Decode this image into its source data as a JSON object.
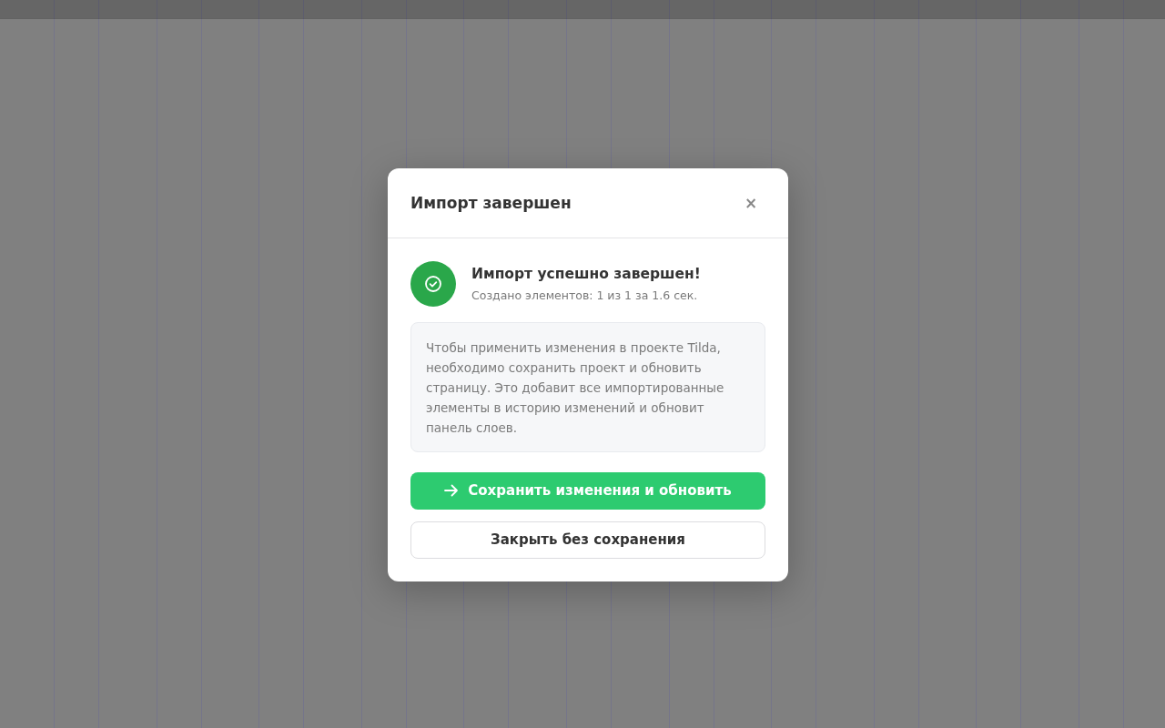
{
  "dialog": {
    "title": "Импорт завершен",
    "close": "×",
    "status": {
      "kind": "success",
      "title": "Импорт успешно завершен!",
      "detail": "Создано элементов: 1 из 1 за 1.6 сек."
    },
    "note": "Чтобы применить изменения в проекте Tilda, необходимо сохранить проект и обновить страницу. Это добавит все импортированные элементы в историю изменений и обновит панель слоев.",
    "buttons": [
      {
        "kind": "primary",
        "label": "Сохранить изменения и обновить"
      },
      {
        "kind": "secondary",
        "label": "Закрыть без сохранения"
      }
    ]
  }
}
